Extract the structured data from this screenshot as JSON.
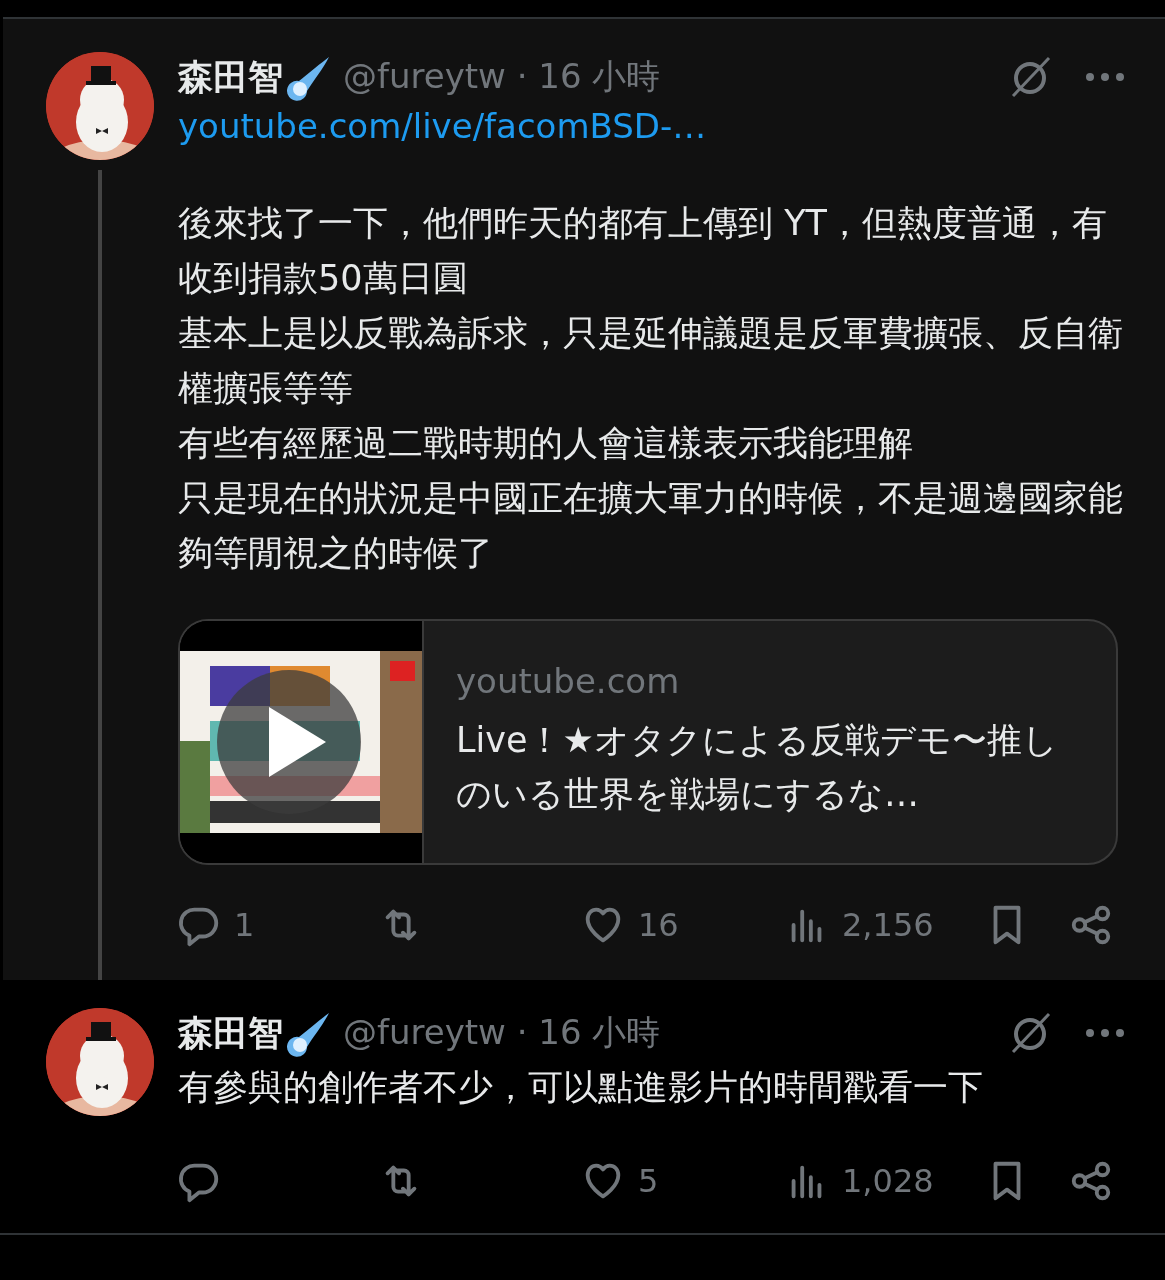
{
  "posts": [
    {
      "highlighted": true,
      "thread_line": true,
      "author": {
        "name": "森田智",
        "handle": "@fureytw",
        "separator": "·",
        "time": "16 小時"
      },
      "link": "youtube.com/live/facomBSD-…",
      "paragraphs": [
        "後來找了一下，他們昨天的都有上傳到 YT，但熱度普通，有收到捐款50萬日圓",
        "基本上是以反戰為訴求，只是延伸議題是反軍費擴張、反自衛權擴張等等",
        "有些有經歷過二戰時期的人會這樣表示我能理解",
        "只是現在的狀況是中國正在擴大軍力的時候，不是週邊國家能夠等閒視之的時候了"
      ],
      "card": {
        "domain": "youtube.com",
        "title": "Live！★オタクによる反戦デモ〜推しのいる世界を戦場にするな…"
      },
      "actions": [
        {
          "kind": "reply",
          "count": "1"
        },
        {
          "kind": "repost"
        },
        {
          "kind": "like",
          "count": "16"
        },
        {
          "kind": "views",
          "count": "2,156"
        },
        {
          "kind": "bookmark"
        },
        {
          "kind": "share"
        }
      ]
    },
    {
      "highlighted": false,
      "thread_line": false,
      "author": {
        "name": "森田智",
        "handle": "@fureytw",
        "separator": "·",
        "time": "16 小時"
      },
      "paragraphs": [
        "有參與的創作者不少，可以點進影片的時間戳看一下"
      ],
      "actions": [
        {
          "kind": "reply"
        },
        {
          "kind": "repost"
        },
        {
          "kind": "like",
          "count": "5"
        },
        {
          "kind": "views",
          "count": "1,028"
        },
        {
          "kind": "bookmark"
        },
        {
          "kind": "share"
        }
      ]
    }
  ]
}
